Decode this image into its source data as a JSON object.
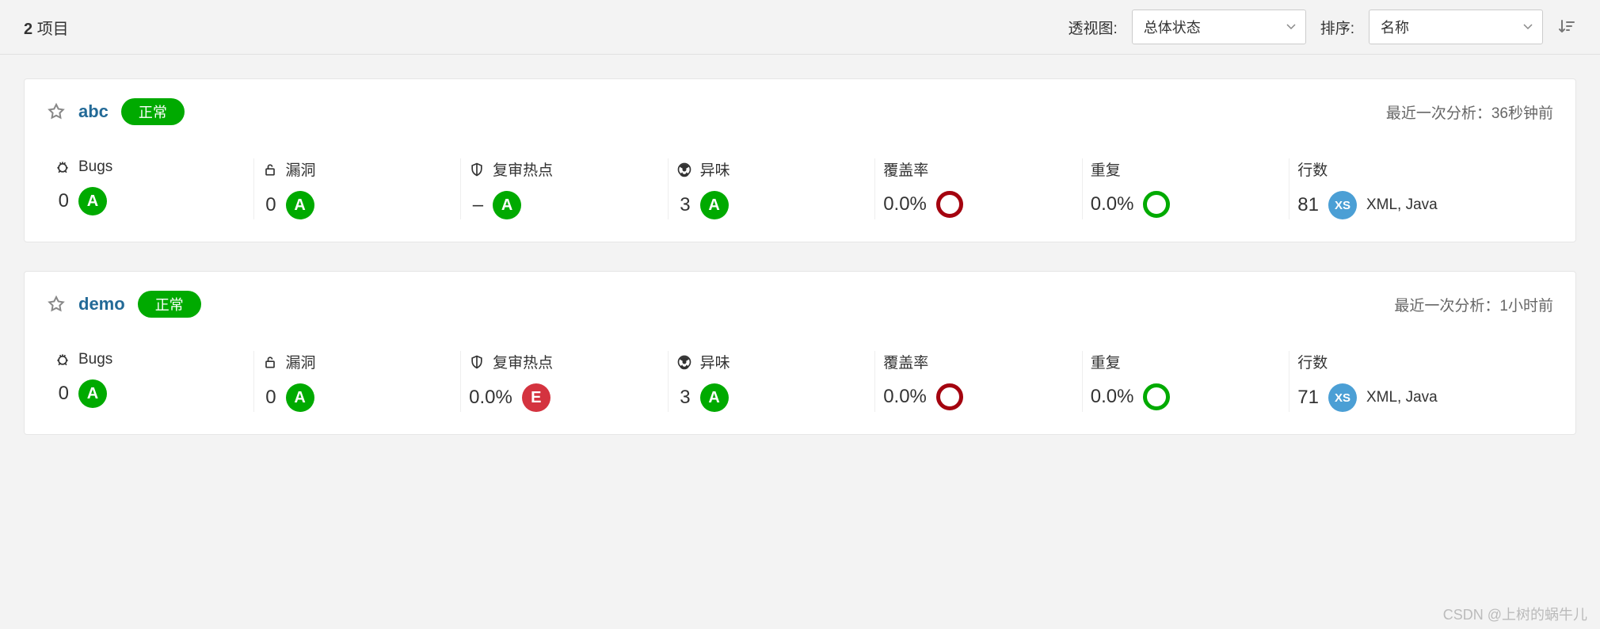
{
  "header": {
    "count": "2",
    "count_label": "项目",
    "perspective_label": "透视图:",
    "perspective_value": "总体状态",
    "sort_label": "排序:",
    "sort_value": "名称"
  },
  "metric_labels": {
    "bugs": "Bugs",
    "vulnerabilities": "漏洞",
    "hotspots": "复审热点",
    "code_smells": "异味",
    "coverage": "覆盖率",
    "duplications": "重复",
    "lines": "行数"
  },
  "last_analysis_label": "最近一次分析：",
  "projects": [
    {
      "name": "abc",
      "status": "正常",
      "last_analysis": "36秒钟前",
      "bugs": {
        "value": "0",
        "rating": "A"
      },
      "vulnerabilities": {
        "value": "0",
        "rating": "A"
      },
      "hotspots": {
        "value": "–",
        "rating": "A"
      },
      "code_smells": {
        "value": "3",
        "rating": "A"
      },
      "coverage": {
        "value": "0.0%",
        "ring": "red"
      },
      "duplications": {
        "value": "0.0%",
        "ring": "green"
      },
      "lines": {
        "value": "81",
        "size": "XS",
        "langs": "XML, Java"
      }
    },
    {
      "name": "demo",
      "status": "正常",
      "last_analysis": "1小时前",
      "bugs": {
        "value": "0",
        "rating": "A"
      },
      "vulnerabilities": {
        "value": "0",
        "rating": "A"
      },
      "hotspots": {
        "value": "0.0%",
        "rating": "E"
      },
      "code_smells": {
        "value": "3",
        "rating": "A"
      },
      "coverage": {
        "value": "0.0%",
        "ring": "red"
      },
      "duplications": {
        "value": "0.0%",
        "ring": "green"
      },
      "lines": {
        "value": "71",
        "size": "XS",
        "langs": "XML, Java"
      }
    }
  ],
  "watermark": "CSDN @上树的蜗牛儿"
}
